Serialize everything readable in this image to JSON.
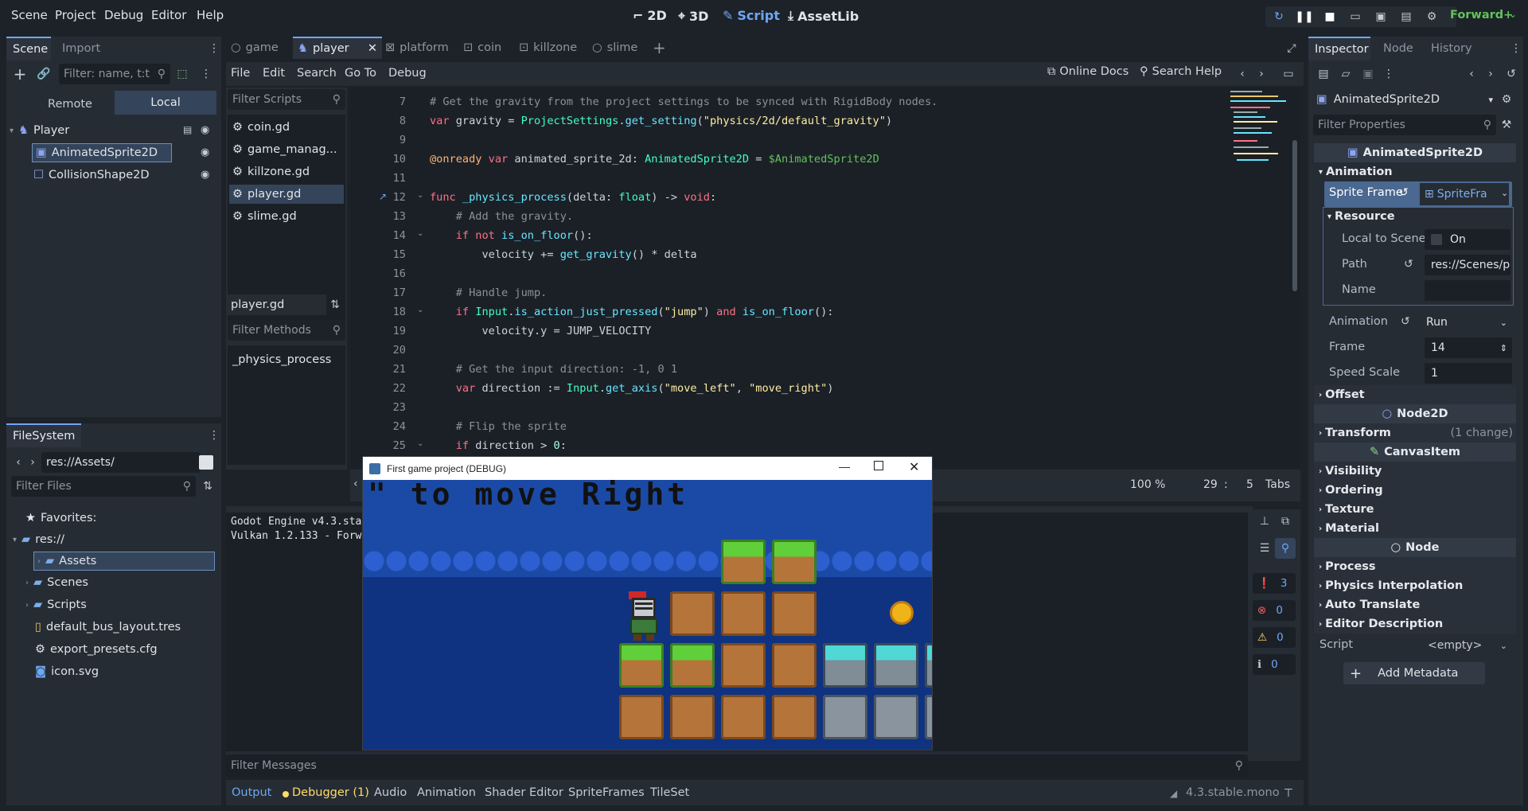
{
  "menubar": {
    "menus": [
      "Scene",
      "Project",
      "Debug",
      "Editor",
      "Help"
    ],
    "workspaces": [
      "2D",
      "3D",
      "Script",
      "AssetLib"
    ],
    "renderer": "Forward+"
  },
  "scene_dock": {
    "tabs": [
      "Scene",
      "Import"
    ],
    "filter_placeholder": "Filter: name, t:t",
    "remote_label": "Remote",
    "local_label": "Local",
    "tree": [
      "Player",
      "AnimatedSprite2D",
      "CollisionShape2D"
    ]
  },
  "filesystem": {
    "tab": "FileSystem",
    "path": "res://Assets/",
    "filter_placeholder": "Filter Files",
    "favorites": "Favorites:",
    "items": [
      "res://",
      "Assets",
      "Scenes",
      "Scripts",
      "default_bus_layout.tres",
      "export_presets.cfg",
      "icon.svg"
    ]
  },
  "editor_tabs": [
    "game",
    "player",
    "platform",
    "coin",
    "killzone",
    "slime"
  ],
  "script_menu": [
    "File",
    "Edit",
    "Search",
    "Go To",
    "Debug"
  ],
  "script_toolbar": {
    "online_docs": "Online Docs",
    "search_help": "Search Help"
  },
  "scripts_panel": {
    "filter_placeholder": "Filter Scripts",
    "scripts": [
      "coin.gd",
      "game_manag...",
      "killzone.gd",
      "player.gd",
      "slime.gd"
    ],
    "current": "player.gd",
    "methods_placeholder": "Filter Methods",
    "methods": [
      "_physics_process"
    ]
  },
  "code": {
    "line_numbers": [
      "7",
      "8",
      "9",
      "10",
      "11",
      "12",
      "13",
      "14",
      "15",
      "16",
      "17",
      "18",
      "19",
      "20",
      "21",
      "22",
      "23",
      "24",
      "25"
    ],
    "status": {
      "zoom": "100 %",
      "line": "29",
      "col": "5",
      "indent": "Tabs"
    }
  },
  "output": {
    "line1": "Godot Engine v4.3.sta",
    "line2": "Vulkan 1.2.133 - Forw",
    "filter_placeholder": "Filter Messages",
    "counts": [
      "3",
      "0",
      "0",
      "0"
    ]
  },
  "bottom_tabs": [
    "Output",
    "Debugger (1)",
    "Audio",
    "Animation",
    "Shader Editor",
    "SpriteFrames",
    "TileSet"
  ],
  "version": "4.3.stable.mono",
  "game_window": {
    "title": "First game project (DEBUG)",
    "banner_text": "\" to move Right"
  },
  "inspector": {
    "tabs": [
      "Inspector",
      "Node",
      "History"
    ],
    "node": "AnimatedSprite2D",
    "filter_placeholder": "Filter Properties",
    "class_header": "AnimatedSprite2D",
    "animation_section": "Animation",
    "sprite_frames_label": "Sprite Frame",
    "sprite_frames_value": "SpriteFra",
    "resource_section": "Resource",
    "local_to_scene_label": "Local to Scene",
    "local_to_scene_value": "On",
    "path_label": "Path",
    "path_value": "res://Scenes/pl",
    "name_label": "Name",
    "animation_label": "Animation",
    "animation_value": "Run",
    "frame_label": "Frame",
    "frame_value": "14",
    "speed_label": "Speed Scale",
    "speed_value": "1",
    "offset": "Offset",
    "node2d": "Node2D",
    "transform": "Transform",
    "transform_note": "(1 change)",
    "canvasitem": "CanvasItem",
    "canvas_sections": [
      "Visibility",
      "Ordering",
      "Texture",
      "Material"
    ],
    "node_header": "Node",
    "node_sections": [
      "Process",
      "Physics Interpolation",
      "Auto Translate",
      "Editor Description"
    ],
    "script_label": "Script",
    "script_value": "<empty>",
    "add_metadata": "Add Metadata"
  },
  "colors": {
    "accent": "#6ea7f2",
    "background": "#1d2229",
    "panel": "#262c34"
  }
}
